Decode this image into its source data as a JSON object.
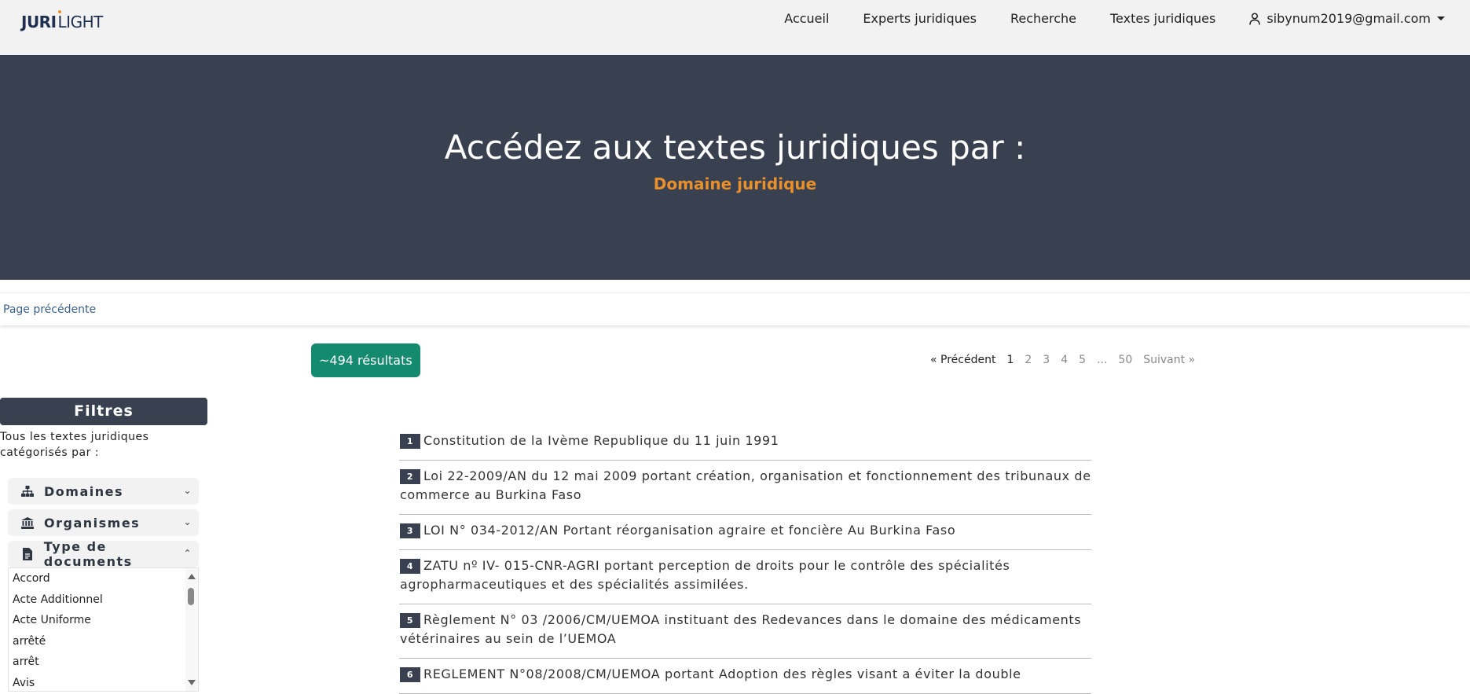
{
  "logo": {
    "part1": "JURI",
    "part2": "LIGHT"
  },
  "nav": {
    "links": [
      "Accueil",
      "Experts juridiques",
      "Recherche",
      "Textes juridiques"
    ],
    "user_email": "sibynum2019@gmail.com"
  },
  "hero": {
    "title": "Accédez aux textes juridiques par :",
    "subtitle": "Domaine juridique",
    "subtitle_color": "#e8902c"
  },
  "back_link": "Page précédente",
  "results_badge": "~494 résultats",
  "pagination": {
    "prev": "« Précédent",
    "pages": [
      "1",
      "2",
      "3",
      "4",
      "5",
      "...",
      "50"
    ],
    "current": "1",
    "next": "Suivant »"
  },
  "filters": {
    "title": "Filtres",
    "description": "Tous les textes juridiques catégorisés par :",
    "facets": [
      {
        "label": "Domaines",
        "icon": "sitemap-icon",
        "expanded": false
      },
      {
        "label": "Organismes",
        "icon": "institution-icon",
        "expanded": false
      },
      {
        "label": "Type de documents",
        "icon": "document-icon",
        "expanded": true
      }
    ],
    "doc_types": [
      "Accord",
      "Acte Additionnel",
      "Acte Uniforme",
      "arrêté",
      "arrêt",
      "Avis"
    ]
  },
  "results": [
    {
      "num": "1",
      "text": "Constitution de la Ivème Republique du 11 juin 1991"
    },
    {
      "num": "2",
      "text": "Loi 22-2009/AN du 12 mai 2009 portant création, organisation et fonctionnement des tribunaux de commerce au Burkina Faso"
    },
    {
      "num": "3",
      "text": "LOI N° 034-2012/AN Portant réorganisation agraire et foncière Au Burkina Faso"
    },
    {
      "num": "4",
      "text": "ZATU nº IV- 015-CNR-AGRI portant perception de droits pour le contrôle des spécialités agropharmaceutiques et des spécialités assimilées."
    },
    {
      "num": "5",
      "text": "Règlement N° 03 /2006/CM/UEMOA instituant des Redevances dans le domaine des médicaments vétérinaires au sein de l’UEMOA"
    },
    {
      "num": "6",
      "text": "REGLEMENT N°08/2008/CM/UEMOA portant Adoption des règles visant a éviter la double"
    }
  ],
  "colors": {
    "dark": "#394150",
    "accent": "#e8902c",
    "badge": "#148a6f"
  }
}
